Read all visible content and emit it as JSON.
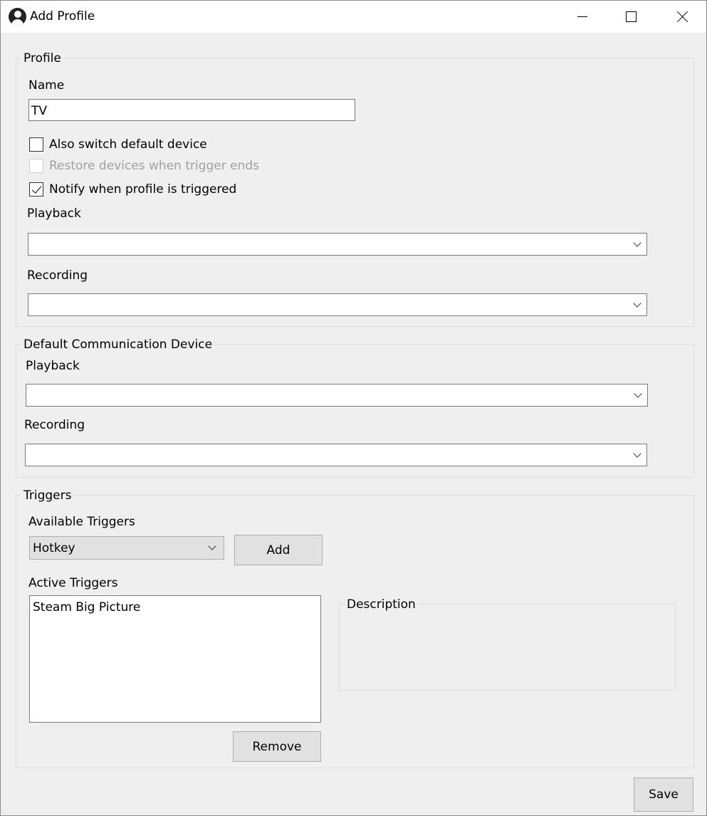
{
  "window": {
    "title": "Add Profile",
    "icon": "user-circle-icon",
    "controls": {
      "minimize": "minimize-icon",
      "maximize": "maximize-icon",
      "close": "close-icon"
    }
  },
  "profile": {
    "group_label": "Profile",
    "name_label": "Name",
    "name_value": "TV",
    "options": [
      {
        "label": "Also switch default device",
        "checked": false,
        "enabled": true
      },
      {
        "label": "Restore devices when trigger ends",
        "checked": false,
        "enabled": false
      },
      {
        "label": "Notify when profile is triggered",
        "checked": true,
        "enabled": true
      }
    ],
    "playback_label": "Playback",
    "playback_value": "",
    "recording_label": "Recording",
    "recording_value": ""
  },
  "communication": {
    "group_label": "Default Communication Device",
    "playback_label": "Playback",
    "playback_value": "",
    "recording_label": "Recording",
    "recording_value": ""
  },
  "triggers": {
    "group_label": "Triggers",
    "available_label": "Available Triggers",
    "available_selected": "Hotkey",
    "add_label": "Add",
    "active_label": "Active Triggers",
    "active_items": [
      "Steam Big Picture"
    ],
    "remove_label": "Remove",
    "description_label": "Description"
  },
  "footer": {
    "save_label": "Save"
  },
  "colors": {
    "background": "#efefef",
    "titlebar": "#ffffff",
    "button": "#e1e1e1",
    "border": "#7a7a7a"
  }
}
